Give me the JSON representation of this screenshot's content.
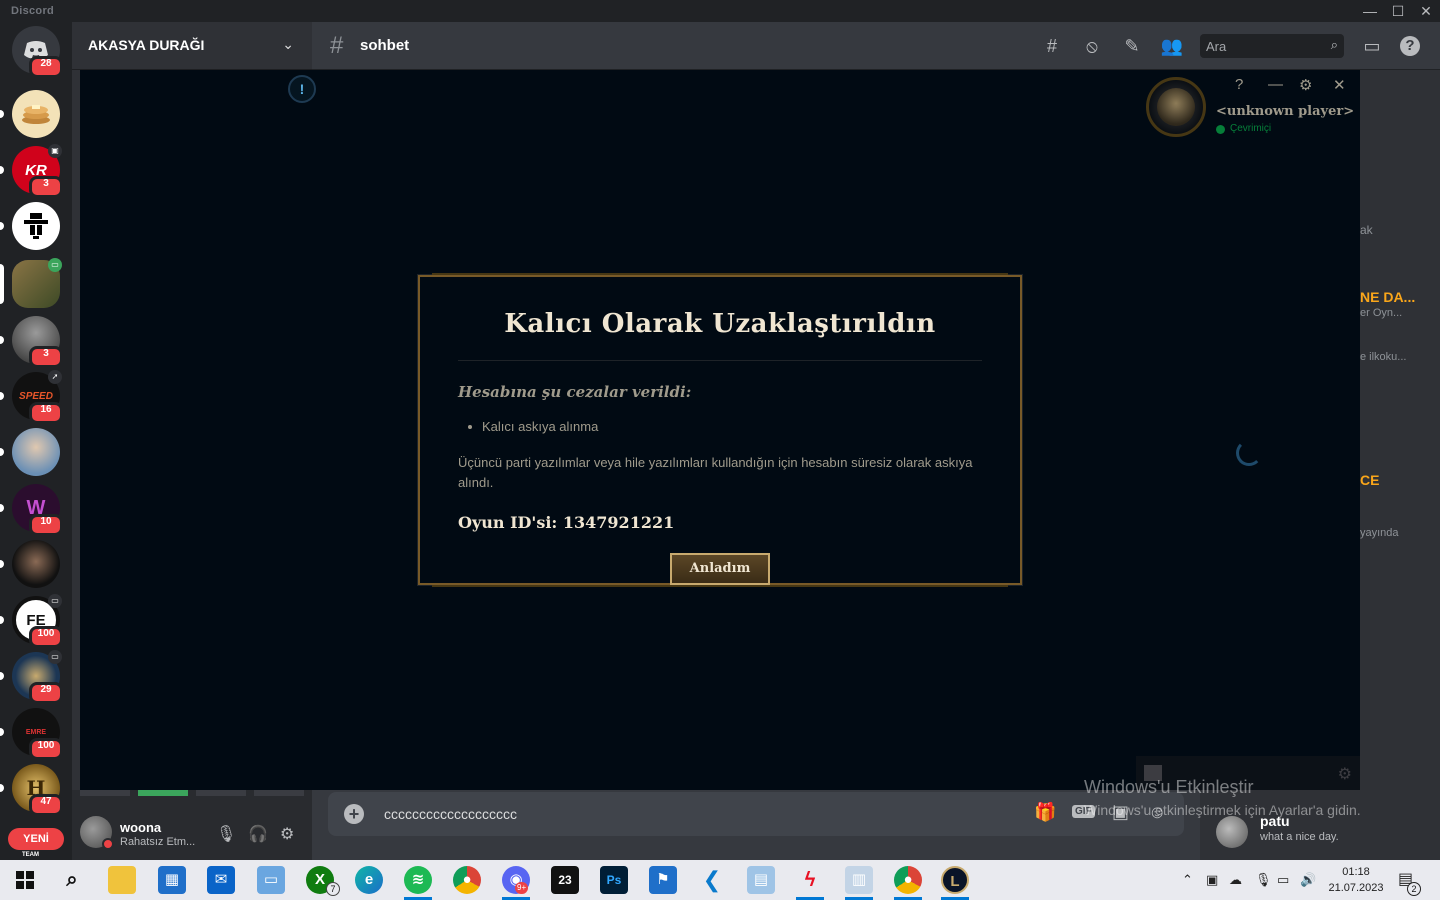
{
  "window": {
    "title": "Discord"
  },
  "server_rail": {
    "home_badge": "28",
    "servers": [
      {
        "name": "pancake",
        "badge": "",
        "color": "#f2c94c"
      },
      {
        "name": "kr",
        "badge": "3",
        "color": "#d0021b"
      },
      {
        "name": "pixel",
        "badge": "",
        "color": "#ffffff"
      },
      {
        "name": "forest",
        "badge": "",
        "color": "#6b5a33"
      },
      {
        "name": "suit",
        "badge": "3",
        "color": "#4a4a4a"
      },
      {
        "name": "speed",
        "badge": "16",
        "color": "#111111"
      },
      {
        "name": "portrait",
        "badge": "",
        "color": "#9ab4d0"
      },
      {
        "name": "w-logo",
        "badge": "10",
        "color": "#2b0d2e"
      },
      {
        "name": "dark-portrait",
        "badge": "",
        "color": "#2a2a2a"
      },
      {
        "name": "fe",
        "badge": "100",
        "color": "#222222"
      },
      {
        "name": "lol",
        "badge": "29",
        "color": "#1c3654"
      },
      {
        "name": "emre",
        "badge": "100",
        "color": "#111111"
      },
      {
        "name": "hogwarts",
        "badge": "47",
        "color": "#c69b3a"
      }
    ],
    "new_label": "YENİ",
    "footer_text": "TEAM"
  },
  "guild": {
    "name": "AKASYA DURAĞI"
  },
  "channel": {
    "name": "sohbet"
  },
  "search": {
    "placeholder": "Ara"
  },
  "members_peek": {
    "snippets": [
      "ak",
      "NE DA...",
      "er Oyn...",
      "e ilkoku...",
      "CE",
      "yayında"
    ],
    "user": {
      "name": "patu",
      "status": "what a nice day."
    }
  },
  "user_panel": {
    "username": "woona",
    "status": "Rahatsız Etm..."
  },
  "composer": {
    "text": "ccccccccccccccccccc",
    "gif_label": "GIF"
  },
  "game_client": {
    "profile_name": "<unknown player>",
    "profile_status": "Çevrimiçi",
    "modal": {
      "title": "Kalıcı Olarak Uzaklaştırıldın",
      "subtitle": "Hesabına şu cezalar verildi:",
      "penalties": [
        "Kalıcı askıya alınma"
      ],
      "body": "Üçüncü parti yazılımlar veya hile yazılımları kullandığın için hesabın süresiz olarak askıya alındı.",
      "game_id": "Oyun ID'si: 1347921221",
      "button": "Anladım"
    }
  },
  "watermark": {
    "line1": "Windows'u Etkinleştir",
    "line2": "Windows'u etkinleştirmek için Ayarlar'a gidin."
  },
  "taskbar": {
    "clock_time": "01:18",
    "clock_date": "21.07.2023",
    "notification_count": "2",
    "xbox_badge": "7",
    "app_badge": "9+"
  },
  "colors": {
    "accent_gold": "#c8aa6e",
    "discord_red": "#ed4245",
    "online_green": "#3ba55c"
  }
}
